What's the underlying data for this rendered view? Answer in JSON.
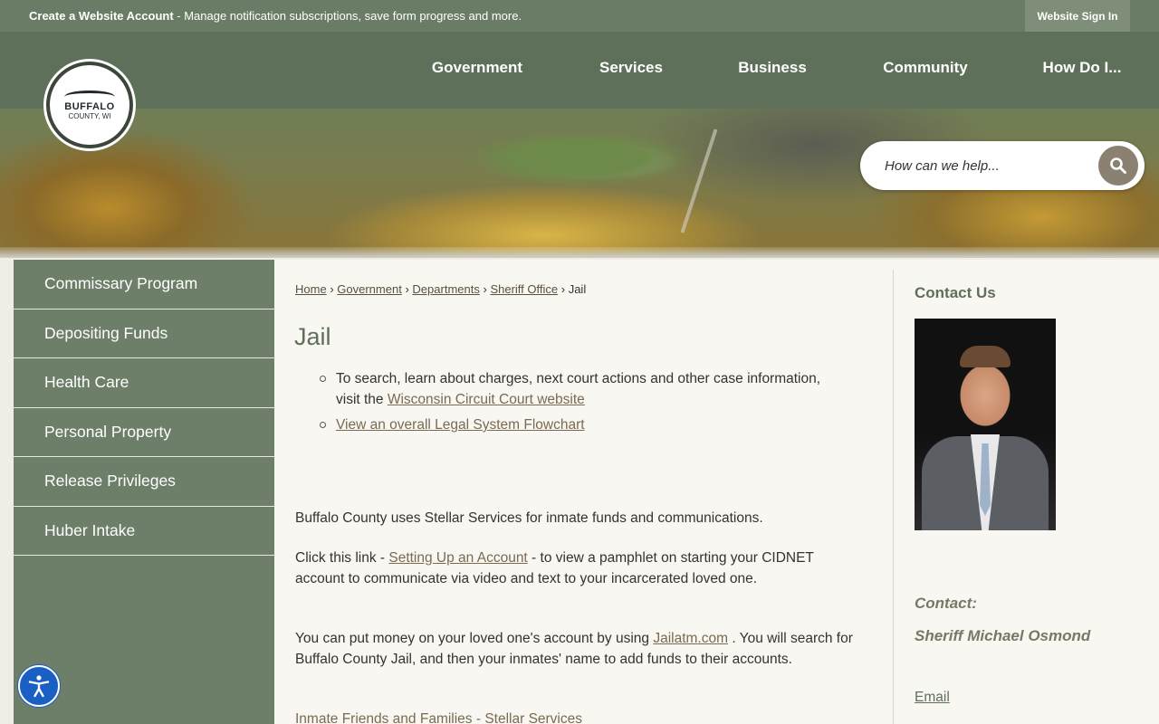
{
  "topbar": {
    "message_bold": "Create a Website Account",
    "message_rest": " - Manage notification subscriptions, save form progress and more.",
    "signin_label": "Website Sign In"
  },
  "logo": {
    "line1": "BUFFALO",
    "line2": "COUNTY, WI"
  },
  "nav": [
    "Government",
    "Services",
    "Business",
    "Community",
    "How Do I..."
  ],
  "search": {
    "placeholder": "How can we help..."
  },
  "sidebar": {
    "items": [
      "Commissary Program",
      "Depositing Funds",
      "Health Care",
      "Personal Property",
      "Release Privileges",
      "Huber Intake"
    ]
  },
  "breadcrumb": {
    "items": [
      "Home",
      "Government",
      "Departments",
      "Sheriff Office"
    ],
    "current": "Jail",
    "separator": "›"
  },
  "page": {
    "title": "Jail",
    "bullet1_text": "To search, learn about charges, next court actions and other case information, visit the ",
    "bullet1_link": "Wisconsin Circuit Court website",
    "bullet2_link": "View an overall Legal System Flowchart",
    "para1": "Buffalo County uses Stellar Services for inmate funds and communications.",
    "para2_before": "Click this link - ",
    "para2_link": "Setting Up an Account",
    "para2_after": " - to view a pamphlet on starting your CIDNET account to communicate via video and text to your incarcerated loved one.",
    "para3_before": "You can put money on your loved one's account by using ",
    "para3_link": "Jailatm.com",
    "para3_after": " .  You will search for Buffalo County Jail, and then your inmates' name to add funds to their accounts.",
    "para4_link": "Inmate Friends and Families - Stellar Services"
  },
  "contact": {
    "heading": "Contact Us",
    "label": "Contact:",
    "name": "Sheriff Michael Osmond",
    "email_label": "Email"
  },
  "colors": {
    "topbar": "#6b7c66",
    "header": "#5f705a",
    "sidebar": "#6e7f69",
    "accessibility": "#1a5fc4"
  }
}
